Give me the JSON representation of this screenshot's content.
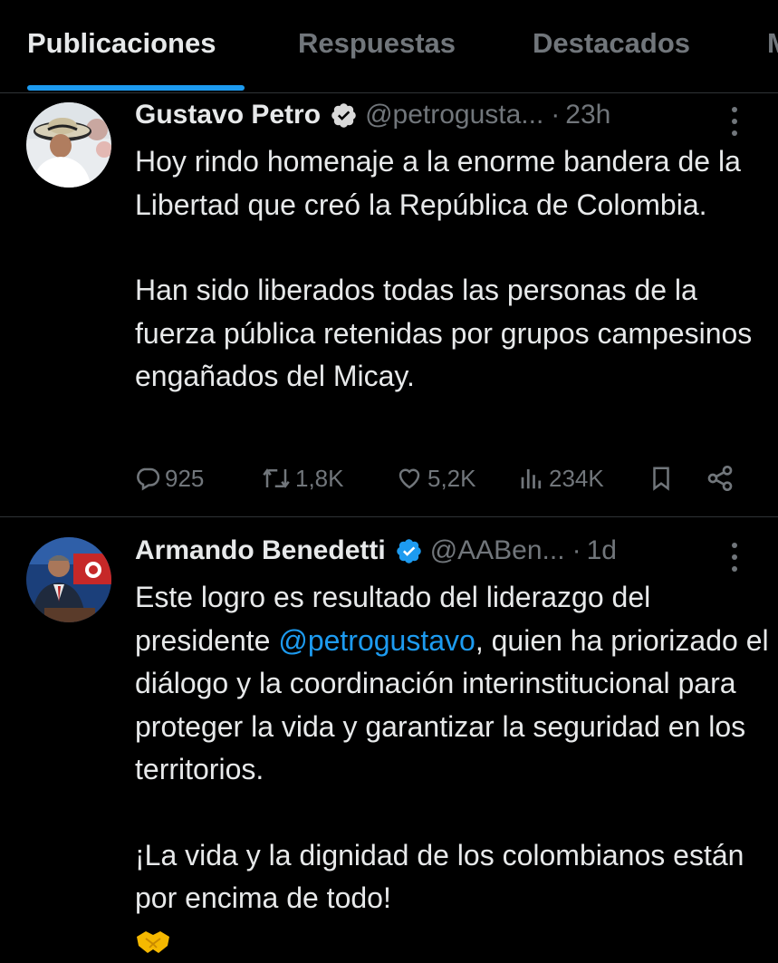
{
  "tabs": [
    {
      "label": "Publicaciones",
      "active": true
    },
    {
      "label": "Respuestas",
      "active": false
    },
    {
      "label": "Destacados",
      "active": false
    },
    {
      "label": "M",
      "active": false
    }
  ],
  "posts": [
    {
      "author": "Gustavo Petro",
      "handle": "@petrogusta...",
      "time": "23h",
      "verified": true,
      "avatar_icon": "avatar-photo-sombrero",
      "paragraphs": [
        "Hoy rindo homenaje a la enorme bandera de la Libertad que creó la República de Colombia.",
        "Han sido liberados todas las personas de la fuerza pública retenidas por grupos campesinos engañados del Micay."
      ],
      "stats": {
        "replies": "925",
        "reposts": "1,8K",
        "likes": "5,2K",
        "views": "234K"
      }
    },
    {
      "author": "Armando Benedetti",
      "handle": "@AABen...",
      "time": "1d",
      "verified": true,
      "avatar_icon": "avatar-photo-podium",
      "text_line1_before": "Este logro es resultado del liderazgo del presidente ",
      "mention": "@petrogustavo",
      "text_line1_after": ", quien ha priorizado el diálogo y la coordinación interinstitucional para proteger la vida y garantizar la seguridad en los territorios.",
      "closing": "¡La vida y la dignidad de los colombianos están por encima de todo!",
      "emojis": [
        "colombia-flag-emoji",
        "handshake-emoji"
      ]
    }
  ],
  "colors": {
    "background": "#000000",
    "text": "#e7e9ea",
    "secondary": "#71767b",
    "accent": "#1d9bf0",
    "divider": "#2f3336"
  }
}
